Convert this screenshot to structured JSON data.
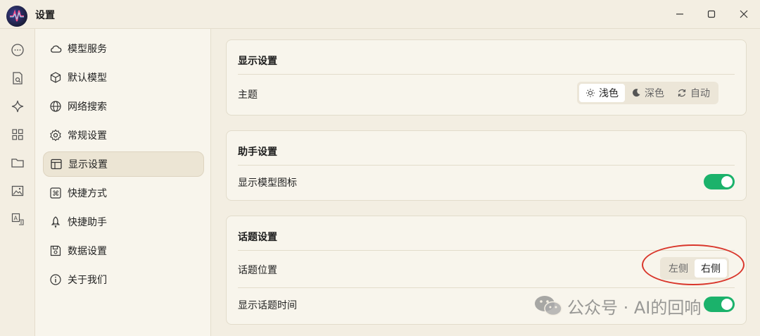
{
  "window": {
    "title": "设置",
    "controls": [
      "minimize",
      "maximize",
      "close"
    ]
  },
  "rail": {
    "icons": [
      "chat-icon",
      "document-search-icon",
      "sparkle-icon",
      "grid-icon",
      "folder-icon",
      "image-icon",
      "translate-icon"
    ]
  },
  "nav": {
    "items": [
      {
        "label": "模型服务",
        "icon": "cloud-icon"
      },
      {
        "label": "默认模型",
        "icon": "cube-icon"
      },
      {
        "label": "网络搜索",
        "icon": "globe-icon"
      },
      {
        "label": "常规设置",
        "icon": "gear-icon"
      },
      {
        "label": "显示设置",
        "icon": "layout-icon",
        "active": true
      },
      {
        "label": "快捷方式",
        "icon": "command-icon"
      },
      {
        "label": "快捷助手",
        "icon": "rocket-icon"
      },
      {
        "label": "数据设置",
        "icon": "save-icon"
      },
      {
        "label": "关于我们",
        "icon": "info-icon"
      }
    ]
  },
  "display": {
    "title": "显示设置",
    "theme_label": "主题",
    "theme_options": [
      {
        "label": "浅色",
        "icon": "sun-icon",
        "selected": true
      },
      {
        "label": "深色",
        "icon": "moon-icon",
        "selected": false
      },
      {
        "label": "自动",
        "icon": "refresh-icon",
        "selected": false
      }
    ]
  },
  "assistant": {
    "title": "助手设置",
    "show_model_icon_label": "显示模型图标",
    "show_model_icon": true
  },
  "topic": {
    "title": "话题设置",
    "position_label": "话题位置",
    "position_options": [
      {
        "label": "左侧",
        "selected": false
      },
      {
        "label": "右侧",
        "selected": true
      }
    ],
    "show_time_label": "显示话题时间",
    "show_time": true
  },
  "watermark": {
    "text": "公众号 · AI的回响"
  },
  "colors": {
    "accent_green": "#1bb26b",
    "annotation_red": "#d9362b"
  }
}
